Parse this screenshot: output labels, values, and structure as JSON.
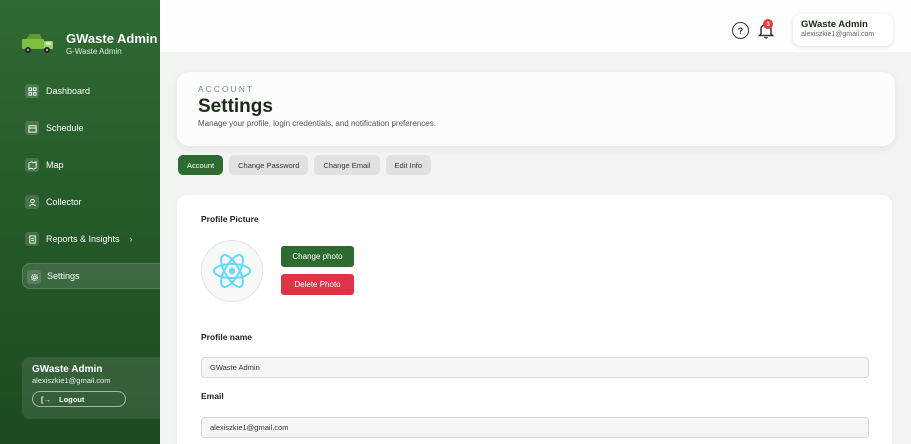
{
  "brand": {
    "title": "GWaste Admin",
    "subtitle": "G-Waste Admin"
  },
  "sidebar": {
    "items": [
      {
        "label": "Dashboard",
        "icon": "grid-icon"
      },
      {
        "label": "Schedule",
        "icon": "calendar-icon"
      },
      {
        "label": "Map",
        "icon": "map-icon"
      },
      {
        "label": "Collector",
        "icon": "user-icon"
      },
      {
        "label": "Reports & Insights",
        "icon": "document-icon",
        "chevron": "›"
      },
      {
        "label": "Settings",
        "icon": "gear-icon",
        "active": true
      }
    ],
    "user": {
      "name": "GWaste Admin",
      "email": "alexiszkie1@gmail.com",
      "logout_label": "Logout"
    }
  },
  "topbar": {
    "help_icon": "?",
    "notification_count": "3",
    "user": {
      "name": "GWaste Admin",
      "email": "alexiszkie1@gmail.com"
    }
  },
  "header": {
    "eyebrow": "ACCOUNT",
    "title": "Settings",
    "subtitle": "Manage your profile, login credentials, and notification preferences."
  },
  "tabs": [
    {
      "label": "Account",
      "active": true
    },
    {
      "label": "Change Password"
    },
    {
      "label": "Change Email"
    },
    {
      "label": "Edit Info"
    }
  ],
  "profile": {
    "picture_label": "Profile Picture",
    "change_photo_label": "Change photo",
    "delete_photo_label": "Delete Photo",
    "name_label": "Profile name",
    "name_value": "GWaste Admin",
    "email_label": "Email",
    "email_value": "alexiszkie1@gmail.com"
  },
  "colors": {
    "primary": "#2e6b30",
    "danger": "#dc3545",
    "sidebar": "#245828",
    "accent": "#6aa06f",
    "react": "#61dafb"
  }
}
